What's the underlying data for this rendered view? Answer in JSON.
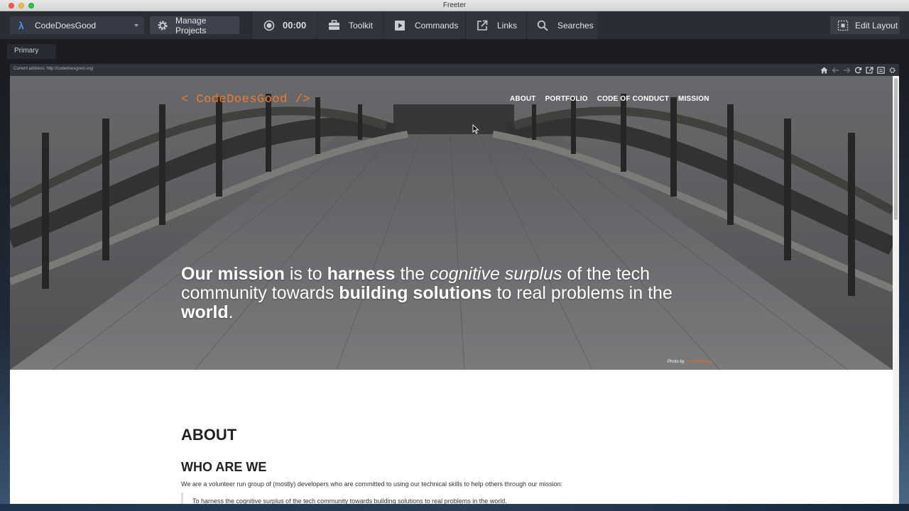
{
  "window": {
    "title": "Freeter"
  },
  "toolbar": {
    "project": "CodeDoesGood",
    "manage_projects": "Manage Projects",
    "timer": "00:00",
    "toolkit": "Toolkit",
    "commands": "Commands",
    "links": "Links",
    "searches": "Searches",
    "edit_layout": "Edit Layout"
  },
  "tabs": [
    {
      "label": "Primary"
    }
  ],
  "browser": {
    "current_address": "Current address: http://codedoesgood.org/"
  },
  "site": {
    "logo": "< CodeDoesGood />",
    "nav": [
      "ABOUT",
      "PORTFOLIO",
      "CODE OF CONDUCT",
      "MISSION"
    ],
    "tagline": {
      "p1": "Our mission",
      "p2": " is to ",
      "p3": "harness",
      "p4": " the ",
      "p5": "cognitive surplus",
      "p6": " of the tech community towards ",
      "p7": "building solutions",
      "p8": " to real problems in the ",
      "p9": "world",
      "p10": "."
    },
    "photo_by": "Photo by",
    "photographer": "Jan Sandberg",
    "about_heading": "ABOUT",
    "who_heading": "WHO ARE WE",
    "intro": "We are a volunteer run group of (mostly) developers who are committed to using our technical skills to help others through our mission:",
    "quote": "To harness the cognitive surplus of the tech community towards building solutions to real problems in the world."
  },
  "colors": {
    "accent_orange": "#f07a2e",
    "lambda_blue": "#4f8ef7",
    "toolbar_bg": "#2a2d34"
  },
  "icons": [
    "lambda-icon",
    "gear-icon",
    "timer-icon",
    "toolbox-icon",
    "play-icon",
    "external-link-icon",
    "search-icon",
    "layout-icon",
    "home-icon",
    "back-icon",
    "forward-icon",
    "reload-icon",
    "open-external-icon",
    "devtools-icon",
    "settings-icon"
  ]
}
